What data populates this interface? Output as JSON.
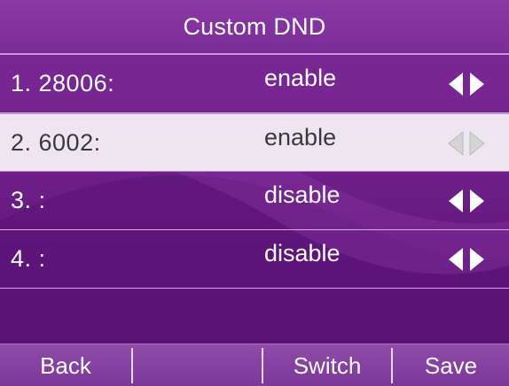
{
  "header": {
    "title": "Custom DND"
  },
  "rows": [
    {
      "label": "1. 28006:",
      "value": "enable",
      "selected": false
    },
    {
      "label": "2. 6002:",
      "value": "enable",
      "selected": true
    },
    {
      "label": "3. :",
      "value": "disable",
      "selected": false
    },
    {
      "label": "4. :",
      "value": "disable",
      "selected": false
    }
  ],
  "softkeys": {
    "back": "Back",
    "empty": "",
    "switch": "Switch",
    "save": "Save"
  },
  "colors": {
    "background": "#6e2088",
    "selected_row": "#ede6f0",
    "arrow_active": "#ffffff",
    "arrow_inactive": "#cfcfcf"
  },
  "icons": {
    "row_control": "left-right-arrows-icon"
  }
}
